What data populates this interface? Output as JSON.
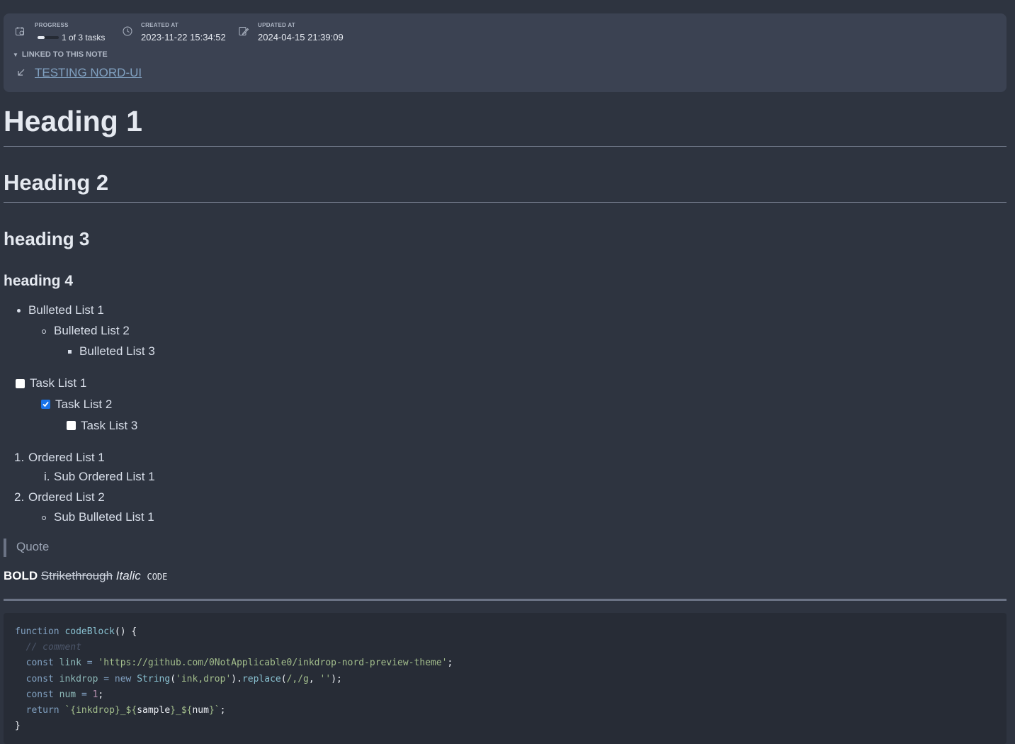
{
  "meta": {
    "progress_label": "PROGRESS",
    "progress_value": "1 of 3 tasks",
    "progress_fraction": 0.333,
    "created_label": "CREATED AT",
    "created_value": "2023-11-22 15:34:52",
    "updated_label": "UPDATED AT",
    "updated_value": "2024-04-15 21:39:09",
    "linked_header": "LINKED TO THIS NOTE",
    "linked_note": "TESTING NORD-UI",
    "icons": {
      "progress": "task-progress-icon",
      "created": "clock-icon",
      "updated": "edit-icon",
      "collapse": "triangle-down-icon",
      "linked": "arrow-down-left-icon"
    }
  },
  "content": {
    "h1": "Heading 1",
    "h2": "Heading 2",
    "h3": "heading 3",
    "h4": "heading 4",
    "bulleted": [
      "Bulleted List 1",
      "Bulleted List 2",
      "Bulleted List 3"
    ],
    "tasks": [
      {
        "label": "Task List 1",
        "checked": false
      },
      {
        "label": "Task List 2",
        "checked": true
      },
      {
        "label": "Task List 3",
        "checked": false
      }
    ],
    "ordered": {
      "item1_marker": "1.",
      "item1": "Ordered List 1",
      "sub1_marker": "i.",
      "sub1": "Sub Ordered List 1",
      "item2_marker": "2.",
      "item2": "Ordered List 2",
      "sub_bullet": "Sub Bulleted List 1"
    },
    "quote": "Quote",
    "format": {
      "bold": "BOLD",
      "strike": "Strikethrough",
      "italic": "Italic",
      "code": "CODE"
    },
    "code_block": {
      "lines": [
        "function codeBlock() {",
        "  // comment",
        "  const link = 'https://github.com/0NotApplicable0/inkdrop-nord-preview-theme';",
        "  const inkdrop = new String('ink,drop').replace(/,/g, '');",
        "  const num = 1;",
        "  return `{inkdrop}_${sample}_${num}`;",
        "}"
      ]
    }
  },
  "colors": {
    "background": "#2e3440",
    "card": "#3b4252",
    "link": "#81a1c1",
    "checkbox_checked": "#1a73e8"
  }
}
